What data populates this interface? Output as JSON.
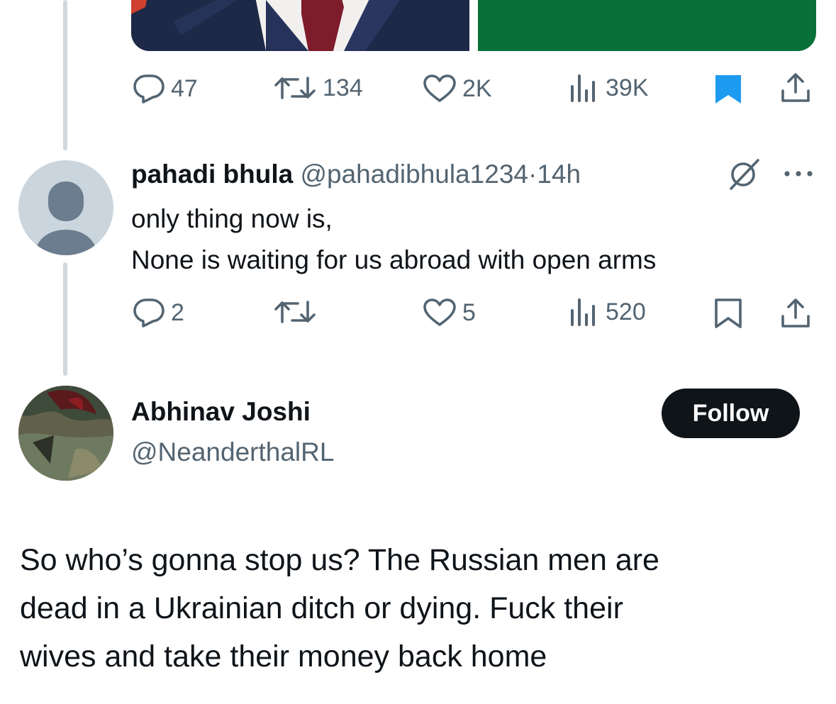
{
  "tweet1": {
    "stats": {
      "replies": "47",
      "retweets": "134",
      "likes": "2K",
      "views": "39K"
    },
    "bookmarked": true
  },
  "reply": {
    "display_name": "pahadi bhula",
    "handle": "@pahadibhula1234",
    "separator": "·",
    "time": "14h",
    "text_line1": "only thing now is,",
    "text_line2": "None is waiting for us abroad with open arms",
    "stats": {
      "replies": "2",
      "retweets": "",
      "likes": "5",
      "views": "520"
    },
    "bookmarked": false
  },
  "main_tweet": {
    "display_name": "Abhinav Joshi",
    "handle": "@NeanderthalRL",
    "follow_label": "Follow",
    "text_line1": "So who’s gonna stop us? The Russian men are",
    "text_line2": "dead in a Ukrainian ditch or dying. Fuck their",
    "text_line3": "wives and take their money back home"
  },
  "colors": {
    "text": "#0f1419",
    "secondary": "#536471",
    "accent": "#1d9bf0",
    "thread_line": "#cfd9de"
  },
  "icons": [
    "reply-icon",
    "retweet-icon",
    "like-icon",
    "views-icon",
    "bookmark-icon",
    "share-icon",
    "grok-icon",
    "more-icon",
    "default-avatar-icon"
  ]
}
